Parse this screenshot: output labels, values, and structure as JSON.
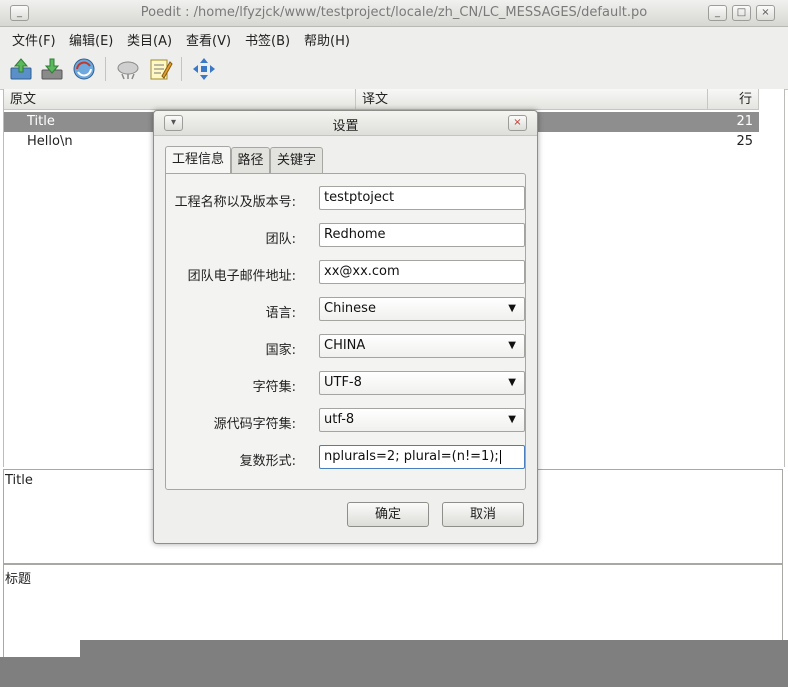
{
  "window": {
    "title": "Poedit : /home/lfyzjck/www/testproject/locale/zh_CN/LC_MESSAGES/default.po",
    "minimize": "_",
    "maximize": "□",
    "close": "×"
  },
  "menu": {
    "items": [
      {
        "label": "文件(F)"
      },
      {
        "label": "编辑(E)"
      },
      {
        "label": "类目(A)"
      },
      {
        "label": "查看(V)"
      },
      {
        "label": "书签(B)"
      },
      {
        "label": "帮助(H)"
      }
    ]
  },
  "toolbar": {
    "icons": [
      "open-icon",
      "save-icon",
      "update-catalog-icon",
      "validate-icon",
      "comment-icon",
      "fullscreen-icon"
    ]
  },
  "list": {
    "headers": {
      "source": "原文",
      "translation": "译文",
      "line": "行"
    },
    "rows": [
      {
        "source": "Title",
        "translation": "",
        "line": "21"
      },
      {
        "source": "Hello\\n",
        "translation": "",
        "line": "25"
      }
    ]
  },
  "panes": {
    "source_text": "Title",
    "translation_text": "标题"
  },
  "dialog": {
    "title": "设置",
    "menu_button": "▾",
    "close_button": "×",
    "tabs": [
      {
        "label": "工程信息"
      },
      {
        "label": "路径"
      },
      {
        "label": "关键字"
      }
    ],
    "fields": {
      "project_label": "工程名称以及版本号:",
      "project_value": "testptoject",
      "team_label": "团队:",
      "team_value": "Redhome",
      "email_label": "团队电子邮件地址:",
      "email_value": "xx@xx.com",
      "language_label": "语言:",
      "language_value": "Chinese",
      "country_label": "国家:",
      "country_value": "CHINA",
      "charset_label": "字符集:",
      "charset_value": "UTF-8",
      "source_charset_label": "源代码字符集:",
      "source_charset_value": "utf-8",
      "plural_label": "复数形式:",
      "plural_value": "nplurals=2; plural=(n!=1);"
    },
    "ok": "确定",
    "cancel": "取消",
    "dropdown_arrow": "▼"
  }
}
